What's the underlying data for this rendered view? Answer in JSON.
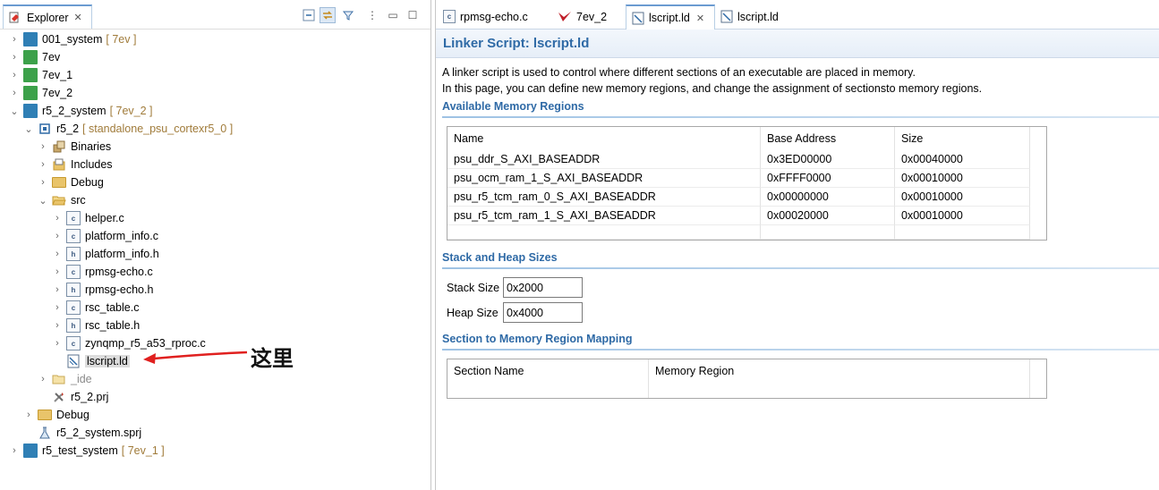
{
  "explorer": {
    "tab_label": "Explorer",
    "toolbar": [
      "collapse-all",
      "link-with-editor",
      "filter",
      "view-menu",
      "minimize",
      "maximize"
    ],
    "tree": [
      {
        "name": "001_system",
        "suffix": "[ 7ev ]",
        "icon": "system-project-icon"
      },
      {
        "name": "7ev",
        "suffix": "",
        "icon": "platform-icon"
      },
      {
        "name": "7ev_1",
        "suffix": "",
        "icon": "platform-icon"
      },
      {
        "name": "7ev_2",
        "suffix": "",
        "icon": "platform-icon"
      },
      {
        "name": "r5_2_system",
        "suffix": "[ 7ev_2 ]",
        "icon": "system-project-icon"
      },
      {
        "name": "r5_2",
        "suffix": "[ standalone_psu_cortexr5_0 ]",
        "icon": "app-project-icon"
      },
      {
        "name": "Binaries",
        "suffix": "",
        "icon": "binaries-icon"
      },
      {
        "name": "Includes",
        "suffix": "",
        "icon": "includes-icon"
      },
      {
        "name": "Debug",
        "suffix": "",
        "icon": "folder-icon"
      },
      {
        "name": "src",
        "suffix": "",
        "icon": "folder-open-icon"
      },
      {
        "name": "helper.c",
        "suffix": "",
        "icon": "c-file-icon"
      },
      {
        "name": "platform_info.c",
        "suffix": "",
        "icon": "c-file-icon"
      },
      {
        "name": "platform_info.h",
        "suffix": "",
        "icon": "h-file-icon"
      },
      {
        "name": "rpmsg-echo.c",
        "suffix": "",
        "icon": "c-file-icon"
      },
      {
        "name": "rpmsg-echo.h",
        "suffix": "",
        "icon": "h-file-icon"
      },
      {
        "name": "rsc_table.c",
        "suffix": "",
        "icon": "c-file-icon"
      },
      {
        "name": "rsc_table.h",
        "suffix": "",
        "icon": "h-file-icon"
      },
      {
        "name": "zynqmp_r5_a53_rproc.c",
        "suffix": "",
        "icon": "c-file-icon"
      },
      {
        "name": "lscript.ld",
        "suffix": "",
        "icon": "linker-script-icon"
      },
      {
        "name": "_ide",
        "suffix": "",
        "icon": "folder-icon"
      },
      {
        "name": "r5_2.prj",
        "suffix": "",
        "icon": "prj-file-icon"
      },
      {
        "name": "Debug",
        "suffix": "",
        "icon": "folder-icon"
      },
      {
        "name": "r5_2_system.sprj",
        "suffix": "",
        "icon": "sprj-file-icon"
      },
      {
        "name": "r5_test_system",
        "suffix": "[ 7ev_1 ]",
        "icon": "system-project-icon"
      }
    ],
    "annotation": "这里"
  },
  "editor": {
    "tabs": [
      {
        "label": "rpmsg-echo.c",
        "icon": "c-file-icon"
      },
      {
        "label": "7ev_2",
        "icon": "vitis-icon"
      },
      {
        "label": "lscript.ld",
        "icon": "linker-script-icon"
      },
      {
        "label": "lscript.ld",
        "icon": "linker-script-icon"
      }
    ],
    "title": "Linker Script: lscript.ld",
    "description_1": "A linker script is used to control where different sections of an executable are placed in memory.",
    "description_2": "In this page, you can define new memory regions, and change the assignment of sectionsto memory regions.",
    "memory_regions": {
      "title": "Available Memory Regions",
      "columns": [
        "Name",
        "Base Address",
        "Size"
      ],
      "rows": [
        [
          "psu_ddr_S_AXI_BASEADDR",
          "0x3ED00000",
          "0x00040000"
        ],
        [
          "psu_ocm_ram_1_S_AXI_BASEADDR",
          "0xFFFF0000",
          "0x00010000"
        ],
        [
          "psu_r5_tcm_ram_0_S_AXI_BASEADDR",
          "0x00000000",
          "0x00010000"
        ],
        [
          "psu_r5_tcm_ram_1_S_AXI_BASEADDR",
          "0x00020000",
          "0x00010000"
        ]
      ]
    },
    "stack_heap": {
      "title": "Stack and Heap Sizes",
      "stack_label": "Stack Size",
      "stack_value": "0x2000",
      "heap_label": "Heap Size",
      "heap_value": "0x4000"
    },
    "section_mapping": {
      "title": "Section to Memory Region Mapping",
      "columns": [
        "Section Name",
        "Memory Region"
      ]
    }
  }
}
